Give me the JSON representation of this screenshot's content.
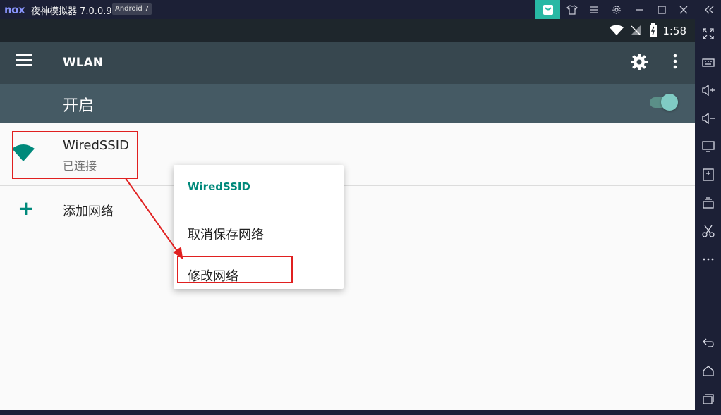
{
  "titlebar": {
    "logo": "nox",
    "title": "夜神模拟器 7.0.0.9",
    "badge": "Android 7"
  },
  "statusbar": {
    "time": "1:58"
  },
  "appbar": {
    "title": "WLAN"
  },
  "switch": {
    "label": "开启",
    "state": "on"
  },
  "networks": [
    {
      "name": "WiredSSID",
      "status": "已连接"
    }
  ],
  "add_network": {
    "label": "添加网络"
  },
  "context_menu": {
    "title": "WiredSSID",
    "items": [
      "取消保存网络",
      "修改网络"
    ]
  },
  "colors": {
    "accent": "#00897b",
    "appbar": "#37474f",
    "switchbar": "#455a64",
    "annotation": "#e02020"
  }
}
